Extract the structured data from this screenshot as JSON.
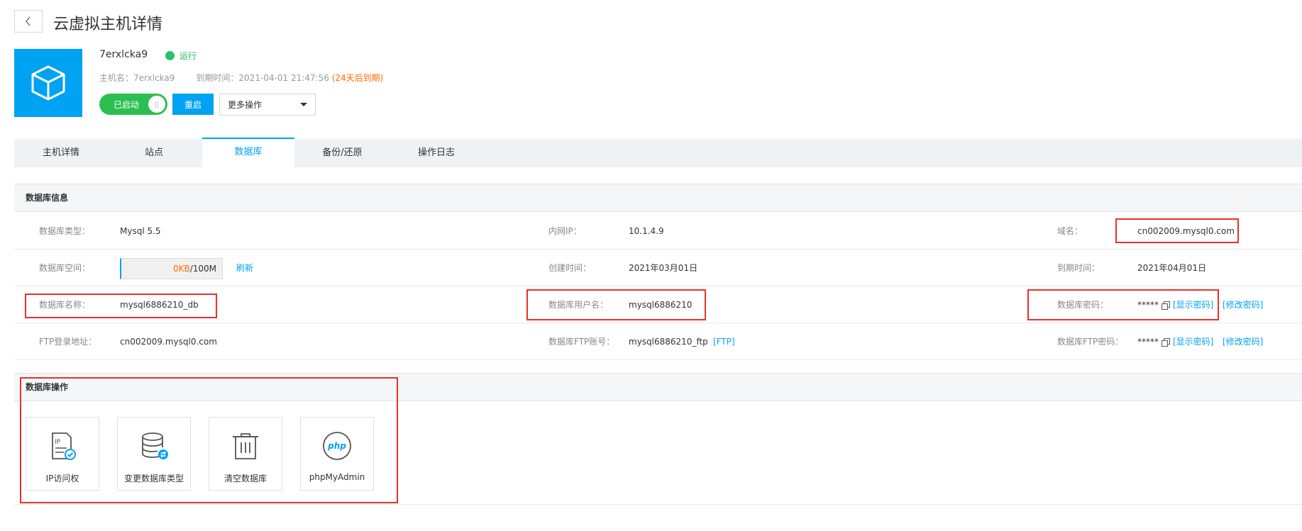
{
  "header": {
    "title": "云虚拟主机详情",
    "host_name": "7erxlcka9",
    "status": "运行",
    "meta_host_label": "主机名：",
    "meta_host_value": "7erxlcka9",
    "meta_expire_label": "到期时间：",
    "meta_expire_value": "2021-04-01 21:47:56",
    "meta_expire_warning": "(24天后到期)",
    "toggle_label": "已启动",
    "restart_label": "重启",
    "more_label": "更多操作"
  },
  "tabs": [
    {
      "label": "主机详情",
      "active": false
    },
    {
      "label": "站点",
      "active": false
    },
    {
      "label": "数据库",
      "active": true
    },
    {
      "label": "备份/还原",
      "active": false
    },
    {
      "label": "操作日志",
      "active": false
    }
  ],
  "db_info": {
    "section_title": "数据库信息",
    "rows": [
      {
        "c1_label": "数据库类型：",
        "c1_value": "Mysql 5.5",
        "c2_label": "内网IP：",
        "c2_value": "10.1.4.9",
        "c3_label": "域名：",
        "c3_value": "cn002009.mysql0.com"
      },
      {
        "c1_label": "数据库空间：",
        "c1_used": "0KB",
        "c1_total": "/100M",
        "c1_refresh": "刷新",
        "c2_label": "创建时间：",
        "c2_value": "2021年03月01日",
        "c3_label": "到期时间：",
        "c3_value": "2021年04月01日"
      },
      {
        "c1_label": "数据库名称：",
        "c1_value": "mysql6886210_db",
        "c2_label": "数据库用户名：",
        "c2_value": "mysql6886210",
        "c3_label": "数据库密码：",
        "c3_value": "*****",
        "c3_show": "[显示密码]",
        "c3_modify": "[修改密码]"
      },
      {
        "c1_label": "FTP登录地址：",
        "c1_value": "cn002009.mysql0.com",
        "c2_label": "数据库FTP账号：",
        "c2_value": "mysql6886210_ftp",
        "c2_link": "[FTP]",
        "c3_label": "数据库FTP密码：",
        "c3_value": "*****",
        "c3_show": "[显示密码]",
        "c3_modify": "[修改密码]"
      }
    ]
  },
  "db_ops": {
    "section_title": "数据库操作",
    "items": [
      {
        "label": "IP访问权",
        "icon": "ip-access-icon"
      },
      {
        "label": "变更数据库类型",
        "icon": "database-switch-icon"
      },
      {
        "label": "清空数据库",
        "icon": "trash-icon"
      },
      {
        "label": "phpMyAdmin",
        "icon": "php-icon",
        "icon_text": "php"
      }
    ]
  },
  "colors": {
    "accent": "#00a2f2",
    "running": "#2bc06b",
    "warning": "#ff6a00",
    "highlight_box": "#e8302c"
  }
}
